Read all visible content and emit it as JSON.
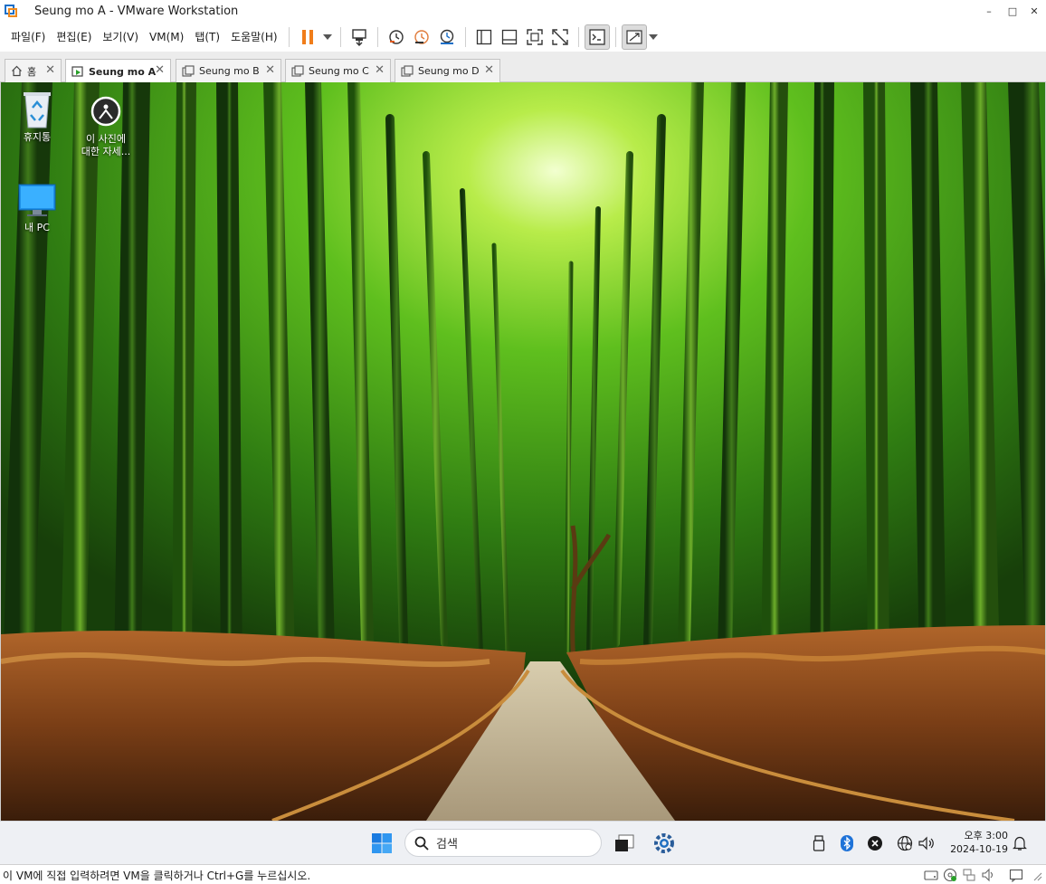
{
  "window": {
    "title": "Seung mo A - VMware Workstation",
    "minimize_glyph": "–",
    "maximize_glyph": "□",
    "close_glyph": "✕"
  },
  "menu": {
    "items": [
      "파일(F)",
      "편집(E)",
      "보기(V)",
      "VM(M)",
      "탭(T)",
      "도움말(H)"
    ]
  },
  "toolbar": {
    "icons": [
      "pause-icon",
      "dropdown-arrow-icon",
      "send-ctrl-alt-del-icon",
      "snapshot-take-icon",
      "snapshot-revert-icon",
      "snapshot-manager-icon",
      "show-library-icon",
      "thumbnail-bar-icon",
      "full-screen-icon",
      "unity-icon",
      "console-view-icon",
      "stretch-guest-icon",
      "dropdown-arrow-icon"
    ],
    "accent_color": "#f07d1a"
  },
  "tabs": [
    {
      "label": "홈",
      "icon": "home-icon",
      "active": false
    },
    {
      "label": "Seung mo A",
      "icon": "vm-running-icon",
      "active": true
    },
    {
      "label": "Seung mo B",
      "icon": "vm-icon",
      "active": false
    },
    {
      "label": "Seung mo C",
      "icon": "vm-icon",
      "active": false
    },
    {
      "label": "Seung mo D",
      "icon": "vm-icon",
      "active": false
    }
  ],
  "tab_close_glyph": "✕",
  "desktop": {
    "icons": [
      {
        "label": "휴지통",
        "icon": "recycle-bin-icon"
      },
      {
        "label": "이 사진에 대한 자세...",
        "label_line1": "이 사진에",
        "label_line2": "대한 자세...",
        "icon": "learn-about-picture-icon"
      },
      {
        "label": "내 PC",
        "icon": "this-pc-icon"
      }
    ]
  },
  "guest_taskbar": {
    "search_placeholder": "검색",
    "time": "오후 3:00",
    "date": "2024-10-19",
    "icons": [
      "windows-start-icon",
      "search-icon",
      "task-view-icon",
      "settings-icon",
      "usb-drive-icon",
      "bluetooth-icon",
      "close-circle-icon",
      "network-icon",
      "volume-icon",
      "notification-bell-icon"
    ]
  },
  "statusbar": {
    "message": "이 VM에 직접 입력하려면 VM을 클릭하거나 Ctrl+G를 누르십시오.",
    "icons": [
      "hard-disk-icon",
      "cd-dvd-icon",
      "network-adapter-icon",
      "sound-card-icon",
      "message-log-icon",
      "resize-grip-icon"
    ]
  }
}
